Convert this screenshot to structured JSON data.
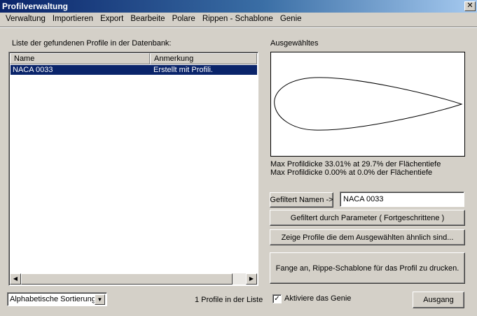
{
  "window": {
    "title": "Profilverwaltung",
    "close_glyph": "✕"
  },
  "menu": [
    "Verwaltung",
    "Importieren",
    "Export",
    "Bearbeite",
    "Polare",
    "Rippen - Schablone",
    "Genie"
  ],
  "list": {
    "label": "Liste der gefundenen Profile in der Datenbank:",
    "columns": [
      "Name",
      "Anmerkung"
    ],
    "rows": [
      {
        "name": "NACA 0033",
        "note": "Erstellt mit Profili."
      }
    ]
  },
  "preview": {
    "label": "Ausgewähltes",
    "info_line1": "Max Profildicke 33.01% at 29.7% der Flächentiefe",
    "info_line2": "Max Profildicke 0.00% at 0.0% der Flächentiefe"
  },
  "filter": {
    "name_button": "Gefiltert Namen ->",
    "name_value": "NACA 0033",
    "param_button": "Gefiltert durch Parameter ( Fortgeschrittene )",
    "similar_button": "Zeige Profile die dem Ausgewählten ähnlich sind...",
    "print_button": "Fange an, Rippe-Schablone für das Profil zu drucken."
  },
  "bottom": {
    "sort_value": "Alphabetische Sortierung",
    "count_text": "1 Profile in der Liste",
    "genie_label": "Aktiviere das Genie",
    "genie_checked": true,
    "exit_button": "Ausgang"
  },
  "icons": {
    "close": "close-icon",
    "left": "arrow-left-icon",
    "right": "arrow-right-icon",
    "dropdown": "chevron-down-icon",
    "check": "check-icon"
  }
}
